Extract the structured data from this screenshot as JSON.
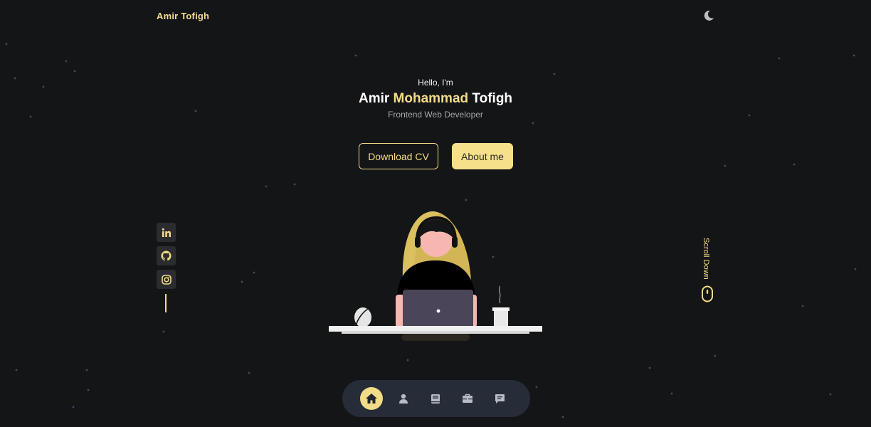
{
  "header": {
    "logo": "Amir Tofigh",
    "theme_icon": "moon-icon"
  },
  "hero": {
    "greeting": "Hello, I'm",
    "name_first": "Amir",
    "name_middle": "Mohammad",
    "name_last": "Tofigh",
    "role": "Frontend Web Developer",
    "download_label": "Download CV",
    "about_label": "About me"
  },
  "social": [
    {
      "icon": "linkedin-icon"
    },
    {
      "icon": "github-icon"
    },
    {
      "icon": "instagram-icon"
    }
  ],
  "scroll": {
    "label": "Scroll Down",
    "icon": "mouse-icon"
  },
  "bottom_nav": [
    {
      "icon": "home-icon",
      "active": true
    },
    {
      "icon": "user-icon",
      "active": false
    },
    {
      "icon": "book-icon",
      "active": false
    },
    {
      "icon": "briefcase-icon",
      "active": false
    },
    {
      "icon": "chat-icon",
      "active": false
    }
  ],
  "colors": {
    "background": "#141517",
    "accent": "#f3dc87",
    "nav_background": "#262c38",
    "social_background": "#2b2c2f"
  }
}
